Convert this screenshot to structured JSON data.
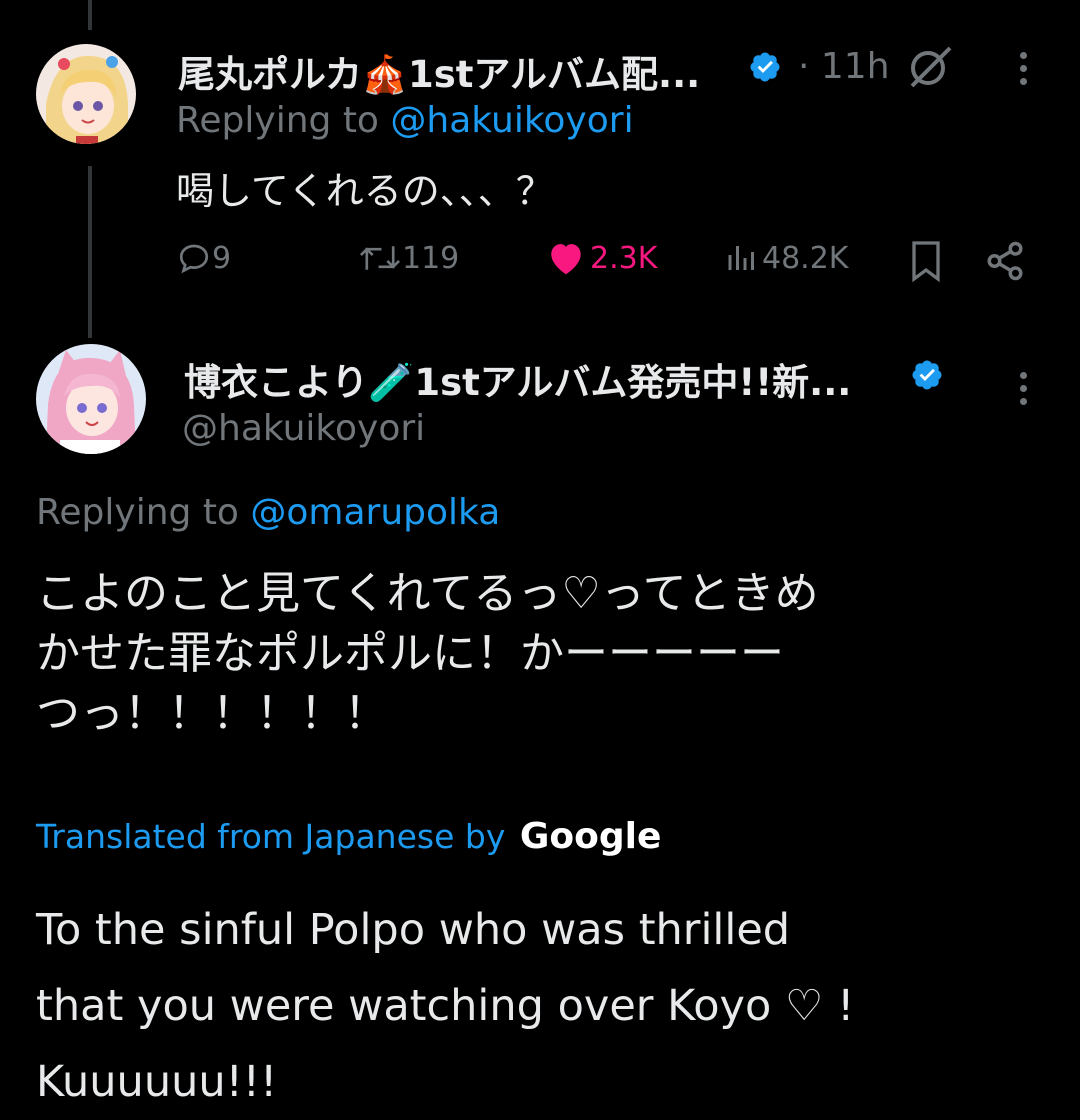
{
  "reply_tweet": {
    "display_name": "尾丸ポルカ🎪1stアルバム配...",
    "time": "· 11h",
    "replying_prefix": "Replying to ",
    "replying_handle": "@hakuikoyori",
    "text": "喝してくれるの、、、？",
    "stats": {
      "replies": "9",
      "retweets": "119",
      "likes": "2.3K",
      "views": "48.2K"
    }
  },
  "main_tweet": {
    "display_name": "博衣こより🧪1stアルバム発売中!!新...",
    "handle": "@hakuikoyori",
    "replying_prefix": "Replying to ",
    "replying_handle": "@omarupolka",
    "text_lines": [
      "こよのこと見てくれてるっ♡ってときめ",
      "かせた罪なポルポルに！かーーーーー",
      "つっ！！！！！！"
    ],
    "translated_label": "Translated from Japanese by",
    "translator": "Google",
    "translation_lines": [
      "To the sinful Polpo who was thrilled",
      "that you were watching over Koyo ♡ !",
      "Kuuuuuu!!!"
    ]
  },
  "colors": {
    "background": "#000000",
    "accent": "#1d9bf0",
    "like": "#f91880",
    "muted": "#71767b"
  },
  "icons": [
    "reply-icon",
    "retweet-icon",
    "heart-icon",
    "views-icon",
    "bookmark-icon",
    "share-icon",
    "grok-icon",
    "more-icon",
    "verified-icon"
  ]
}
